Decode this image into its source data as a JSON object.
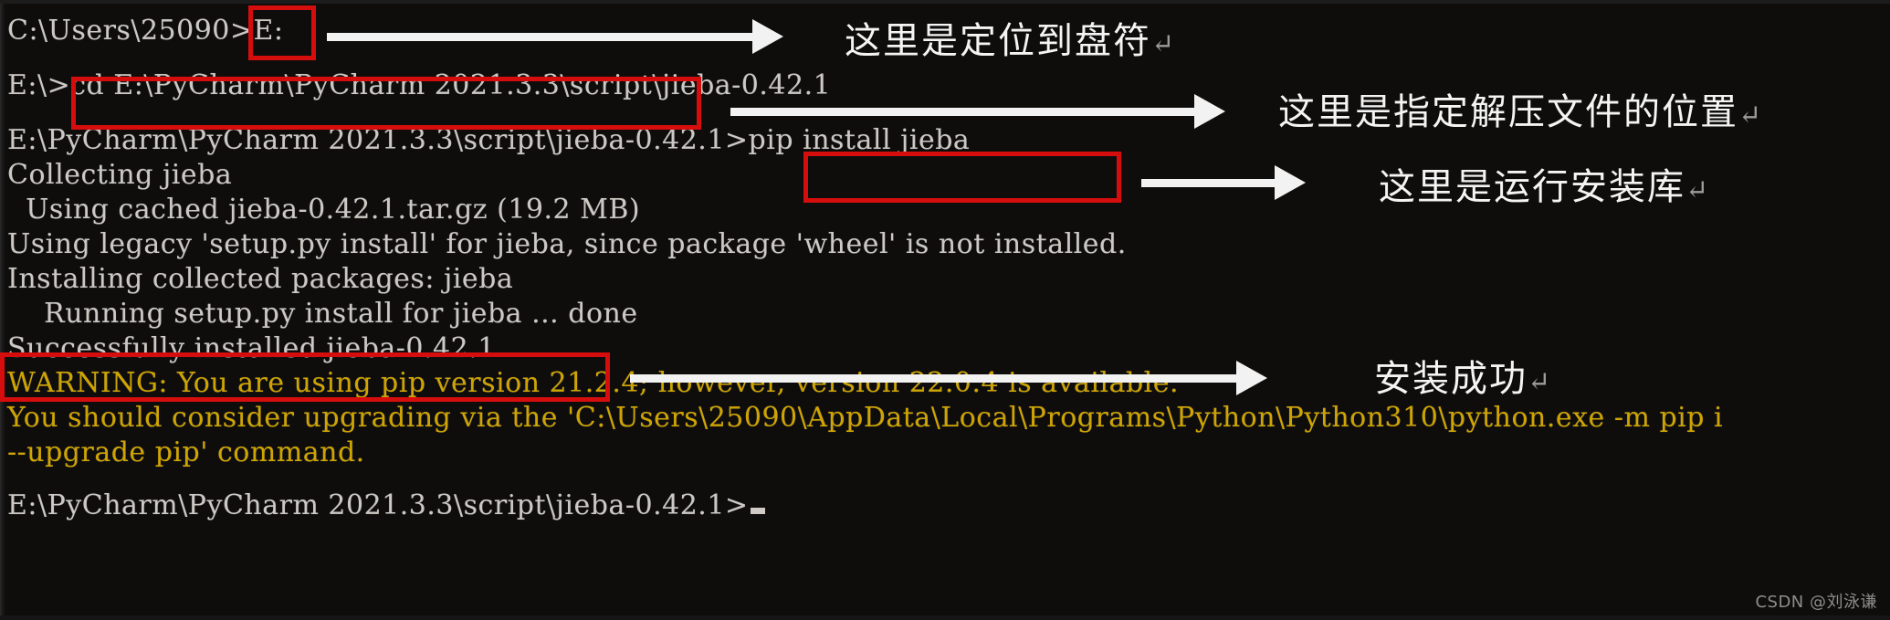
{
  "terminal": {
    "background_color": "#0e0d0c",
    "text_color": "#ccc9c4",
    "warning_color": "#cfa400",
    "highlight_color": "#d60d0d",
    "arrow_color": "#f2f2f2",
    "lines": [
      {
        "id": "l1",
        "text": "C:\\Users\\25090>E:",
        "kind": "prompt"
      },
      {
        "id": "l2",
        "text": "",
        "kind": "blank"
      },
      {
        "id": "l3",
        "text": "E:\\>cd E:\\PyCharm\\PyCharm 2021.3.3\\script\\jieba-0.42.1",
        "kind": "prompt"
      },
      {
        "id": "l4",
        "text": "",
        "kind": "blank"
      },
      {
        "id": "l5",
        "text": "E:\\PyCharm\\PyCharm 2021.3.3\\script\\jieba-0.42.1>pip install jieba",
        "kind": "prompt"
      },
      {
        "id": "l6",
        "text": "Collecting jieba",
        "kind": "output"
      },
      {
        "id": "l7",
        "text": "  Using cached jieba-0.42.1.tar.gz (19.2 MB)",
        "kind": "output"
      },
      {
        "id": "l8",
        "text": "Using legacy 'setup.py install' for jieba, since package 'wheel' is not installed.",
        "kind": "output"
      },
      {
        "id": "l9",
        "text": "Installing collected packages: jieba",
        "kind": "output"
      },
      {
        "id": "l10",
        "text": "    Running setup.py install for jieba ... done",
        "kind": "output"
      },
      {
        "id": "l11",
        "text": "Successfully installed jieba-0.42.1",
        "kind": "output"
      },
      {
        "id": "l12",
        "text": "WARNING: You are using pip version 21.2.4; however, version 22.0.4 is available.",
        "kind": "warning"
      },
      {
        "id": "l13",
        "text": "You should consider upgrading via the 'C:\\Users\\25090\\AppData\\Local\\Programs\\Python\\Python310\\python.exe -m pip i",
        "kind": "warning"
      },
      {
        "id": "l14",
        "text": "--upgrade pip' command.",
        "kind": "warning"
      },
      {
        "id": "l15",
        "text": "",
        "kind": "blank"
      },
      {
        "id": "l16",
        "text": "E:\\PyCharm\\PyCharm 2021.3.3\\script\\jieba-0.42.1>",
        "kind": "prompt-cursor"
      }
    ]
  },
  "annotations": [
    {
      "id": "a1",
      "text": "这里是定位到盘符",
      "enter_mark": "↵"
    },
    {
      "id": "a2",
      "text": "这里是指定解压文件的位置",
      "enter_mark": "↵"
    },
    {
      "id": "a3",
      "text": "这里是运行安装库",
      "enter_mark": "↵"
    },
    {
      "id": "a4",
      "text": "安装成功",
      "enter_mark": "↵"
    }
  ],
  "highlight_targets": [
    {
      "id": "h1",
      "label": "E:"
    },
    {
      "id": "h2",
      "label": "cd E:\\PyCharm\\PyCharm 2021.3.3\\script\\jieba-0.42.1"
    },
    {
      "id": "h3",
      "label": "pip install jieba"
    },
    {
      "id": "h4",
      "label": "Successfully installed jieba-0.42.1"
    }
  ],
  "watermark": {
    "text": "CSDN @刘泳谦"
  }
}
